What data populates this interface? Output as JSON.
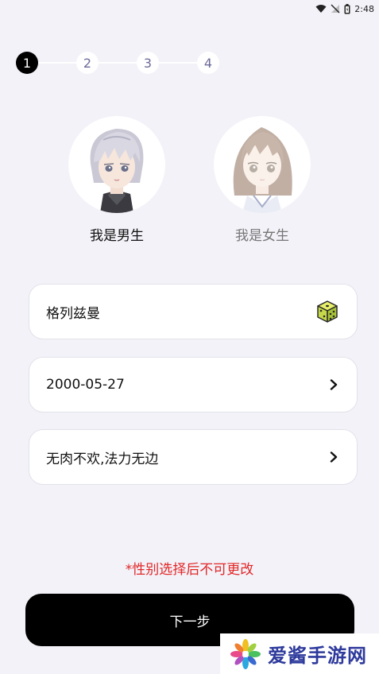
{
  "status_bar": {
    "time": "2:48"
  },
  "stepper": {
    "steps": [
      "1",
      "2",
      "3",
      "4"
    ],
    "current": 1
  },
  "gender": {
    "male_label": "我是男生",
    "female_label": "我是女生",
    "selected": "male"
  },
  "form": {
    "nickname": "格列兹曼",
    "birthday": "2000-05-27",
    "signature": "无肉不欢,法力无边"
  },
  "warning": "*性别选择后不可更改",
  "next_button": "下一步",
  "watermark": {
    "text": "爱酱手游网"
  },
  "colors": {
    "accent": "#000000",
    "warning": "#e22727",
    "background": "#f2f2f8"
  }
}
